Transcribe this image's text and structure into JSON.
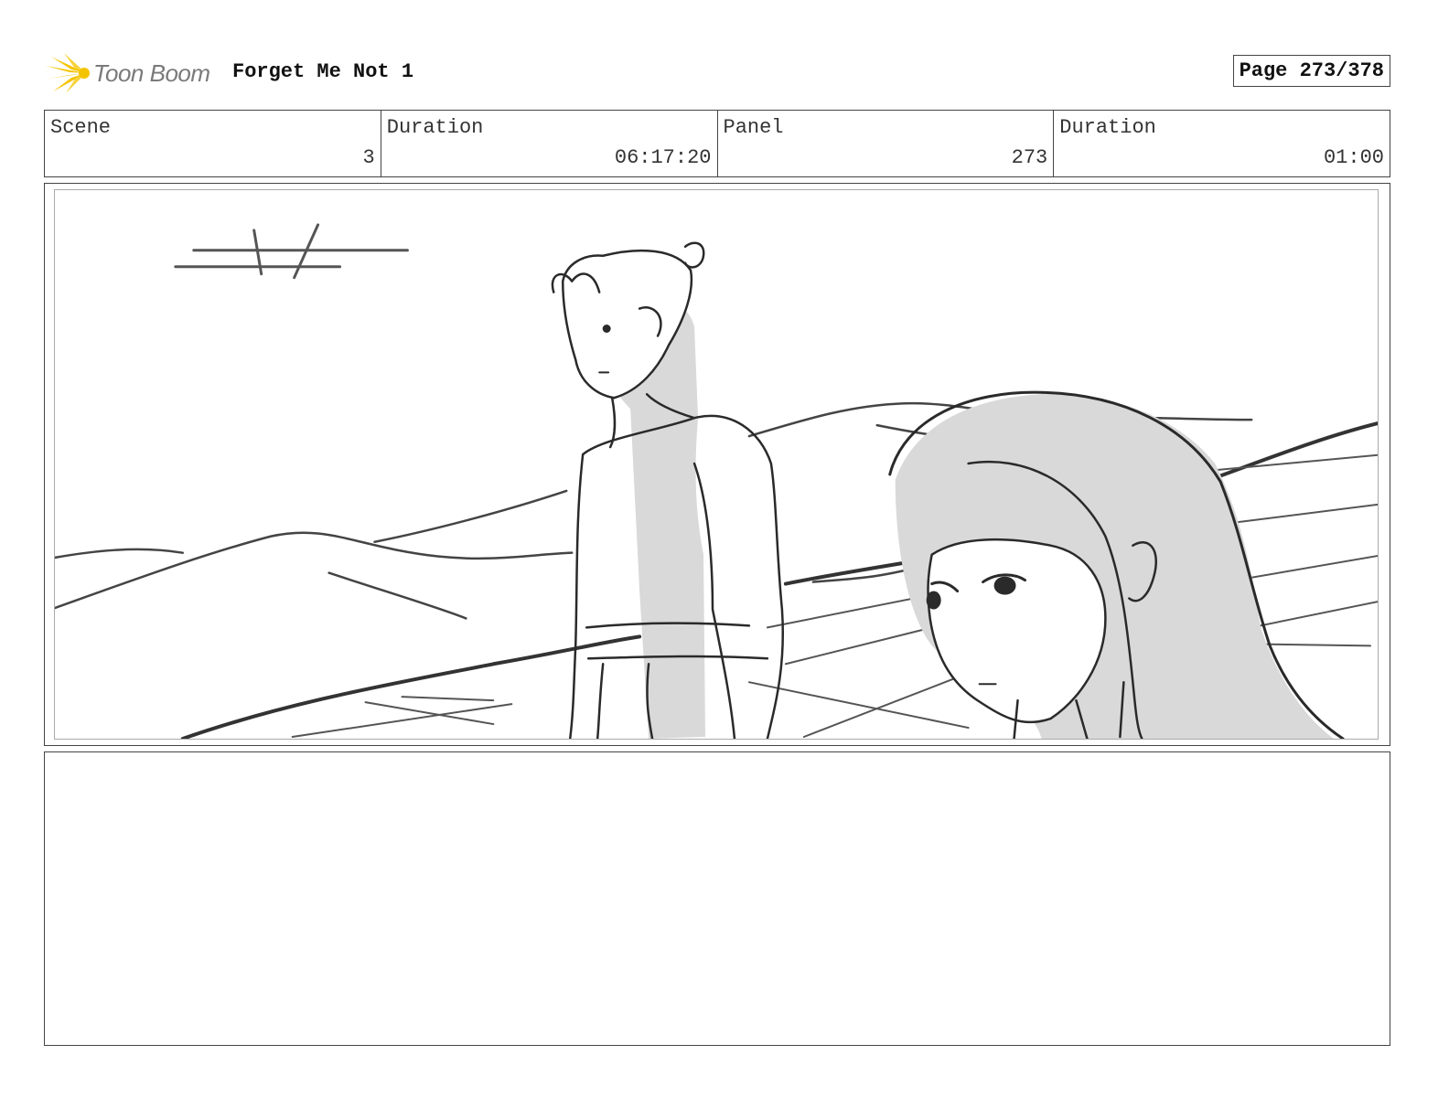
{
  "header": {
    "logo_text": "Toon Boom",
    "title": "Forget Me Not 1",
    "page": "Page 273/378"
  },
  "info": {
    "scene_label": "Scene",
    "scene_value": "3",
    "scene_duration_label": "Duration",
    "scene_duration_value": "06:17:20",
    "panel_label": "Panel",
    "panel_value": "273",
    "panel_duration_label": "Duration",
    "panel_duration_value": "01:00"
  },
  "notes": {
    "text": ""
  },
  "colors": {
    "logo_yellow": "#f5c400",
    "logo_gray": "#7a7a7a",
    "border": "#444444",
    "sketch_shade": "#d9d9d9",
    "sketch_line": "#2a2a2a"
  }
}
